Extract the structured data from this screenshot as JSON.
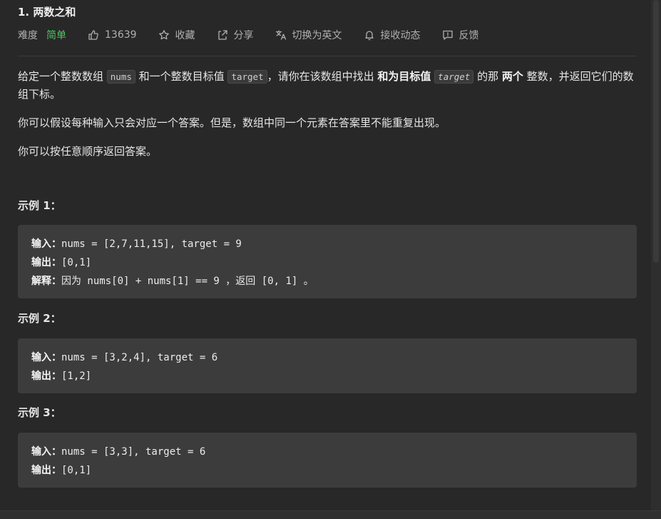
{
  "problem": {
    "title": "1. 两数之和",
    "difficulty_label": "难度",
    "difficulty": "简单",
    "likes": "13639",
    "favorite_label": "收藏",
    "share_label": "分享",
    "switch_lang_label": "切换为英文",
    "subscribe_label": "接收动态",
    "feedback_label": "反馈"
  },
  "description": {
    "p1_a": "给定一个整数数组 ",
    "p1_code1": "nums",
    "p1_b": " 和一个整数目标值 ",
    "p1_code2": "target",
    "p1_c": "，请你在该数组中找出 ",
    "p1_bold1": "和为目标值",
    "p1_code3": "target",
    "p1_d": " 的那 ",
    "p1_bold2": "两个",
    "p1_e": " 整数，并返回它们的数组下标。",
    "p2": "你可以假设每种输入只会对应一个答案。但是，数组中同一个元素在答案里不能重复出现。",
    "p3": "你可以按任意顺序返回答案。"
  },
  "labels": {
    "input": "输入：",
    "output": "输出：",
    "explain": "解释："
  },
  "examples": [
    {
      "title": "示例 1：",
      "input": "nums = [2,7,11,15], target = 9",
      "output": "[0,1]",
      "explain_a": "因为",
      "explain_b": " nums[0] + nums[1] == 9 ",
      "explain_c": "，返回",
      "explain_d": " [0, 1] ",
      "explain_e": "。"
    },
    {
      "title": "示例 2：",
      "input": "nums = [3,2,4], target = 6",
      "output": "[1,2]"
    },
    {
      "title": "示例 3：",
      "input": "nums = [3,3], target = 6",
      "output": "[0,1]"
    }
  ],
  "colors": {
    "background": "#282828",
    "difficulty_easy": "#4ec463",
    "code_block": "#3c3c3c"
  },
  "icons": [
    "thumbs-up-icon",
    "star-icon",
    "share-icon",
    "translate-icon",
    "bell-icon",
    "feedback-icon"
  ]
}
